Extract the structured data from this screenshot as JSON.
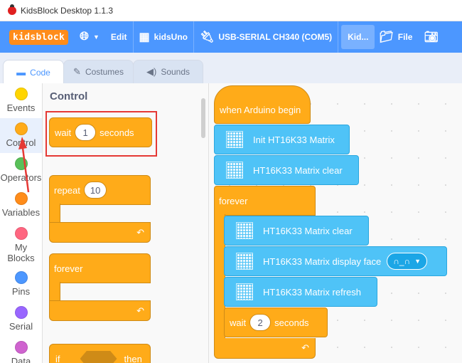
{
  "window": {
    "title": "KidsBlock Desktop 1.1.3"
  },
  "menubar": {
    "logo": "kidsblock",
    "language_icon": "globe-icon",
    "edit": "Edit",
    "board": "kidsUno",
    "port": "USB-SERIAL CH340 (COM5)",
    "kid": "Kid...",
    "file": "File"
  },
  "tabs": [
    {
      "label": "Code",
      "active": true
    },
    {
      "label": "Costumes",
      "active": false
    },
    {
      "label": "Sounds",
      "active": false
    }
  ],
  "categories": [
    {
      "label": "Events",
      "color": "#ffd500"
    },
    {
      "label": "Control",
      "color": "#ffab19",
      "active": true
    },
    {
      "label": "Operators",
      "color": "#59c059"
    },
    {
      "label": "Variables",
      "color": "#ff8c1a"
    },
    {
      "label": "My\nBlocks",
      "color": "#ff6680"
    },
    {
      "label": "Pins",
      "color": "#4c97ff"
    },
    {
      "label": "Serial",
      "color": "#9966ff"
    },
    {
      "label": "Data",
      "color": "#cf63cf"
    }
  ],
  "palette": {
    "heading": "Control",
    "wait": {
      "pre": "wait",
      "value": "1",
      "post": "seconds"
    },
    "repeat": {
      "label": "repeat",
      "value": "10"
    },
    "forever": {
      "label": "forever"
    },
    "if": {
      "pre": "if",
      "post": "then"
    }
  },
  "workspace": {
    "hat": "when Arduino begin",
    "init": "Init HT16K33 Matrix",
    "clear1": "HT16K33 Matrix clear",
    "forever": "forever",
    "clear2": "HT16K33 Matrix clear",
    "face_label": "HT16K33 Matrix display face",
    "face_value": "∩_∩",
    "refresh": "HT16K33 Matrix refresh",
    "wait": {
      "pre": "wait",
      "value": "2",
      "post": "seconds"
    }
  },
  "colors": {
    "accent": "#4c97ff",
    "control": "#ffab19",
    "arduino": "#4fc3f7",
    "highlight": "#e53935"
  }
}
